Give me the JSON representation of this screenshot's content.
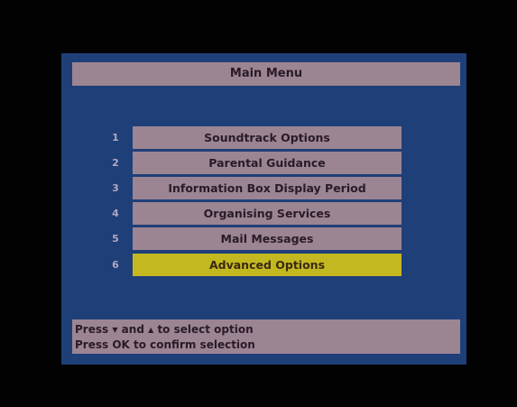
{
  "menu": {
    "title": "Main Menu",
    "items": [
      {
        "number": "1",
        "label": "Soundtrack Options",
        "selected": false
      },
      {
        "number": "2",
        "label": "Parental Guidance",
        "selected": false
      },
      {
        "number": "3",
        "label": "Information Box Display Period",
        "selected": false
      },
      {
        "number": "4",
        "label": "Organising Services",
        "selected": false
      },
      {
        "number": "5",
        "label": "Mail Messages",
        "selected": false
      },
      {
        "number": "6",
        "label": "Advanced Options",
        "selected": true
      }
    ]
  },
  "help": {
    "line1_press": "Press",
    "line1_and": "and",
    "line1_rest": "to select option",
    "line2": "Press OK to confirm selection",
    "down_icon": "▼",
    "up_icon": "▲"
  },
  "colors": {
    "panel": "#1f3f78",
    "item": "#9b8593",
    "selected": "#c4b821"
  }
}
